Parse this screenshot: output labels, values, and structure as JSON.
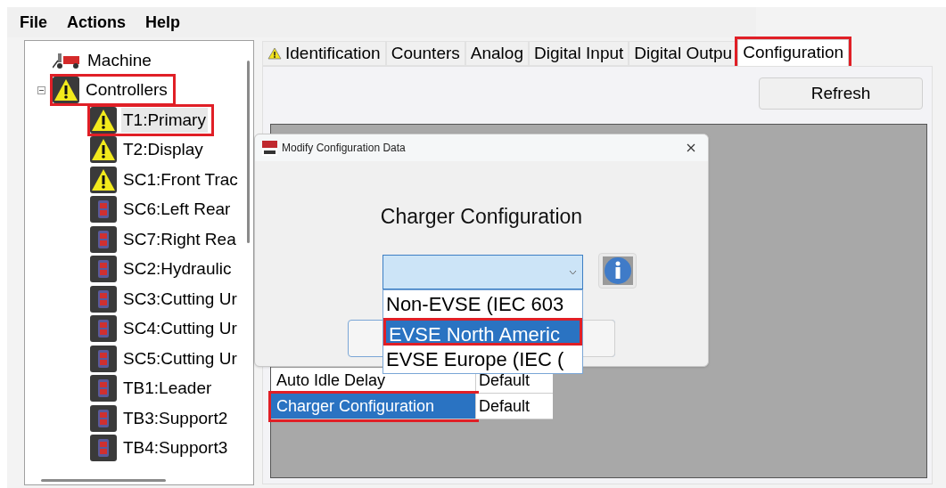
{
  "menu": [
    "File",
    "Actions",
    "Help"
  ],
  "tree": [
    {
      "label": "Machine",
      "kind": "machine",
      "highlighted": false,
      "selected": false
    },
    {
      "label": "Controllers",
      "kind": "warning",
      "highlighted": true,
      "selected": false,
      "expanded": true,
      "children": [
        {
          "label": "T1:Primary",
          "kind": "warning",
          "highlighted": true,
          "selected": true
        },
        {
          "label": "T2:Display",
          "kind": "warning",
          "highlighted": false,
          "selected": false
        },
        {
          "label": "SC1:Front Trac",
          "kind": "warning",
          "highlighted": false,
          "selected": false
        },
        {
          "label": "SC6:Left Rear",
          "kind": "module",
          "highlighted": false,
          "selected": false
        },
        {
          "label": "SC7:Right Rea",
          "kind": "module",
          "highlighted": false,
          "selected": false
        },
        {
          "label": "SC2:Hydraulic",
          "kind": "module",
          "highlighted": false,
          "selected": false
        },
        {
          "label": "SC3:Cutting Ur",
          "kind": "module",
          "highlighted": false,
          "selected": false
        },
        {
          "label": "SC4:Cutting Ur",
          "kind": "module",
          "highlighted": false,
          "selected": false
        },
        {
          "label": "SC5:Cutting Ur",
          "kind": "module",
          "highlighted": false,
          "selected": false
        },
        {
          "label": "TB1:Leader",
          "kind": "module",
          "highlighted": false,
          "selected": false
        },
        {
          "label": "TB3:Support2",
          "kind": "module",
          "highlighted": false,
          "selected": false
        },
        {
          "label": "TB4:Support3",
          "kind": "module",
          "highlighted": false,
          "selected": false
        }
      ]
    }
  ],
  "tabs": [
    {
      "label": "Identification",
      "warning": true,
      "selected": false,
      "highlighted": false
    },
    {
      "label": "Counters",
      "warning": false,
      "selected": false,
      "highlighted": false
    },
    {
      "label": "Analog",
      "warning": false,
      "selected": false,
      "highlighted": false
    },
    {
      "label": "Digital Input",
      "warning": false,
      "selected": false,
      "highlighted": false
    },
    {
      "label": "Digital Outpu",
      "warning": false,
      "selected": false,
      "highlighted": false
    },
    {
      "label": "Configuration",
      "warning": false,
      "selected": true,
      "highlighted": true
    }
  ],
  "refresh_button": "Refresh",
  "table": {
    "rows": [
      {
        "description": "Auto Idle Delay",
        "value": "Default",
        "selected": false,
        "highlighted": false
      },
      {
        "description": "Charger Configuration",
        "value": "Default",
        "selected": true,
        "highlighted": true
      }
    ]
  },
  "dialog": {
    "title": "Modify Configuration Data",
    "heading": "Charger Configuration",
    "options": [
      {
        "label": "Non-EVSE (IEC 603",
        "selected": false,
        "highlighted": false
      },
      {
        "label": "EVSE North Americ",
        "selected": true,
        "highlighted": true
      },
      {
        "label": "EVSE Europe (IEC (",
        "selected": false,
        "highlighted": false
      }
    ]
  }
}
